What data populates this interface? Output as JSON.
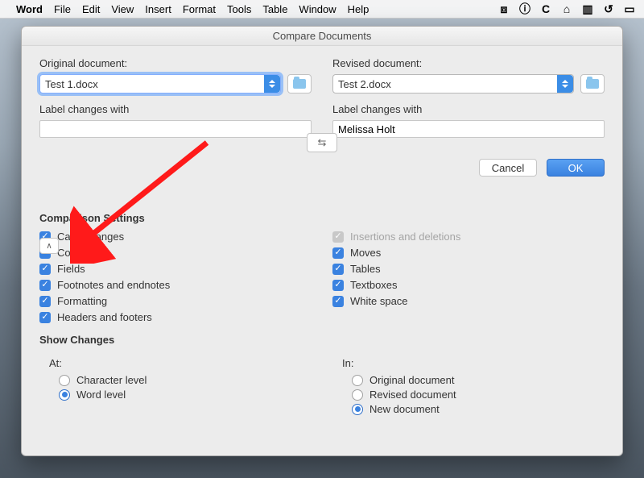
{
  "menubar": {
    "app": "Word",
    "items": [
      "File",
      "Edit",
      "View",
      "Insert",
      "Format",
      "Tools",
      "Table",
      "Window",
      "Help"
    ]
  },
  "dialog": {
    "title": "Compare Documents",
    "original_label": "Original document:",
    "revised_label": "Revised document:",
    "original_value": "Test 1.docx",
    "revised_value": "Test 2.docx",
    "label_changes": "Label changes with",
    "original_author": "",
    "revised_author": "Melissa Holt",
    "cancel": "Cancel",
    "ok": "OK",
    "comparison_heading": "Comparison Settings",
    "checks_left": [
      "Case changes",
      "Comments",
      "Fields",
      "Footnotes and endnotes",
      "Formatting",
      "Headers and footers"
    ],
    "checks_right": [
      "Insertions and deletions",
      "Moves",
      "Tables",
      "Textboxes",
      "White space"
    ],
    "show_heading": "Show Changes",
    "at_label": "At:",
    "in_label": "In:",
    "at_options": [
      "Character level",
      "Word level"
    ],
    "in_options": [
      "Original document",
      "Revised document",
      "New document"
    ],
    "at_selected": 1,
    "in_selected": 2
  }
}
